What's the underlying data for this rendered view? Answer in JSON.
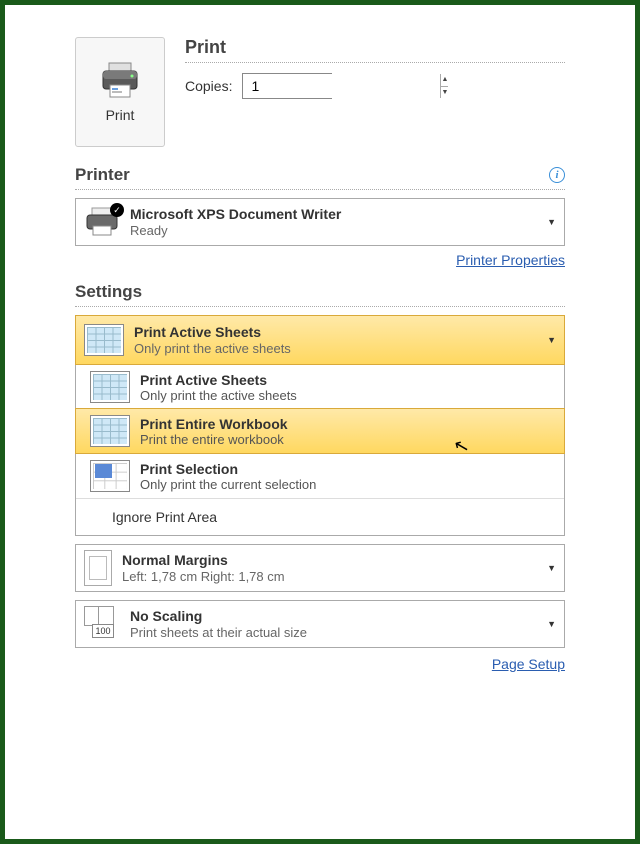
{
  "print_tile": {
    "label": "Print"
  },
  "print_section": {
    "title": "Print",
    "copies_label": "Copies:",
    "copies_value": "1"
  },
  "printer_section": {
    "title": "Printer",
    "selected": {
      "name": "Microsoft XPS Document Writer",
      "status": "Ready"
    },
    "properties_link": "Printer Properties"
  },
  "settings_section": {
    "title": "Settings",
    "selected": {
      "title": "Print Active Sheets",
      "sub": "Only print the active sheets"
    },
    "options": [
      {
        "title": "Print Active Sheets",
        "sub": "Only print the active sheets"
      },
      {
        "title": "Print Entire Workbook",
        "sub": "Print the entire workbook"
      },
      {
        "title": "Print Selection",
        "sub": "Only print the current selection"
      }
    ],
    "ignore_label": "Ignore Print Area",
    "margins": {
      "title": "Normal Margins",
      "sub": "Left: 1,78 cm   Right: 1,78 cm"
    },
    "scaling": {
      "title": "No Scaling",
      "sub": "Print sheets at their actual size",
      "badge": "100"
    },
    "page_setup_link": "Page Setup"
  }
}
